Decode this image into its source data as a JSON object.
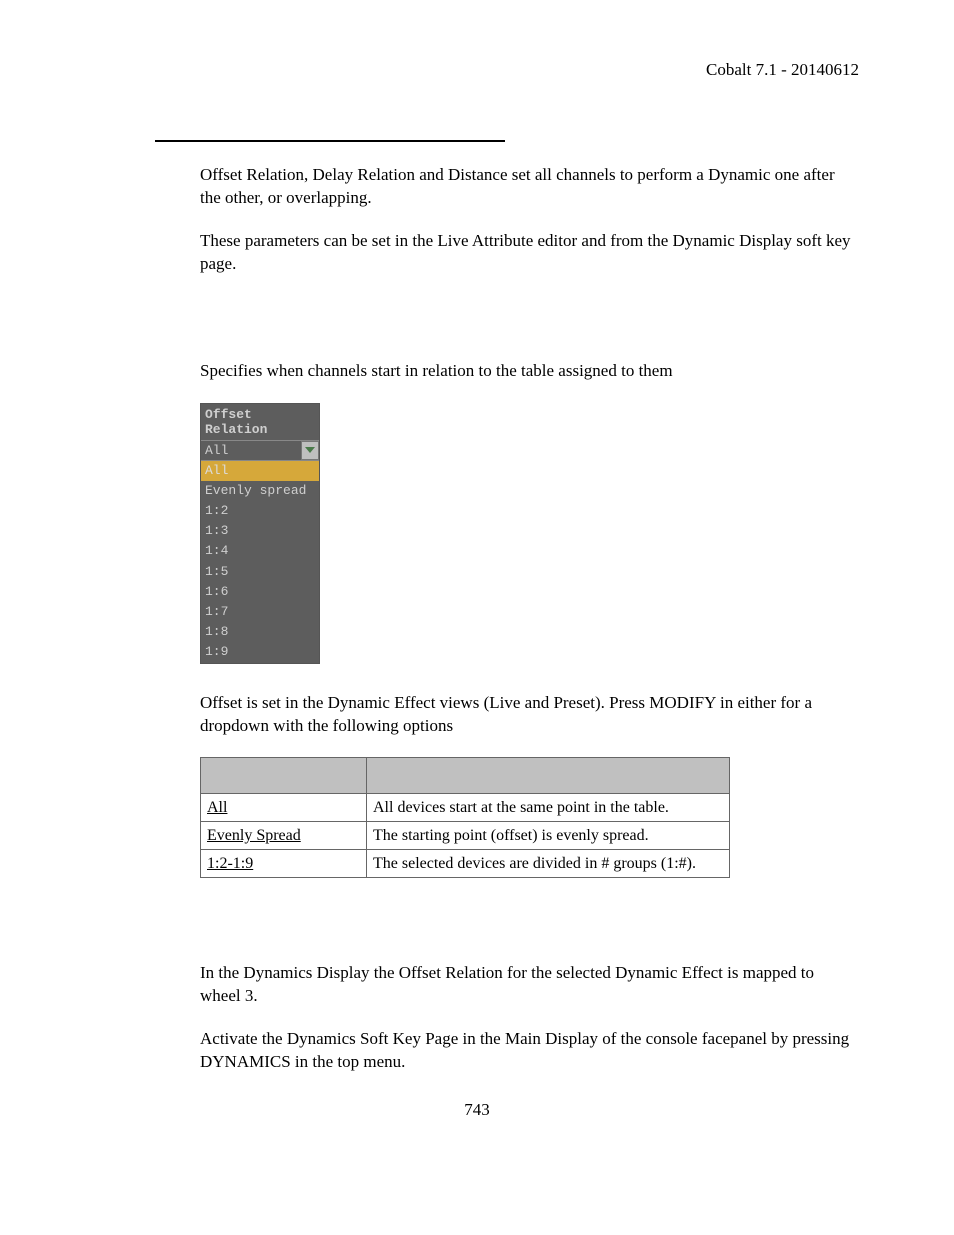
{
  "header": {
    "doc_title": "Cobalt 7.1 - 20140612"
  },
  "intro": {
    "para1": "Offset Relation, Delay Relation and Distance set all channels to perform a Dynamic one after the other, or overlapping.",
    "para2": "These parameters can be set in the Live Attribute editor and from the Dynamic Display soft key page."
  },
  "offset_section": {
    "desc": "Specifies when channels start in relation to the table assigned to them",
    "dropdown": {
      "title": "Offset Relation",
      "selected": "All",
      "options": [
        "All",
        "Evenly spread",
        "1:2",
        "1:3",
        "1:4",
        "1:5",
        "1:6",
        "1:7",
        "1:8",
        "1:9"
      ]
    },
    "after_dd": "Offset is set in the Dynamic Effect views (Live and Preset). Press MODIFY in either for a dropdown with the following options",
    "table": {
      "header1": "",
      "header2": "",
      "rows": [
        {
          "label": "All",
          "expl": "All devices start at the same point in the table."
        },
        {
          "label": "Evenly Spread",
          "expl": "The starting point (offset) is evenly spread."
        },
        {
          "label": "1:2-1:9",
          "expl": "The selected devices are divided in # groups (1:#)."
        }
      ]
    }
  },
  "footer_paras": {
    "p1": "In the Dynamics Display the Offset Relation for the selected Dynamic Effect is mapped to wheel 3.",
    "p2": "Activate the Dynamics Soft Key Page in the Main Display of the console facepanel by pressing DYNAMICS in the top menu."
  },
  "page_number": "743"
}
